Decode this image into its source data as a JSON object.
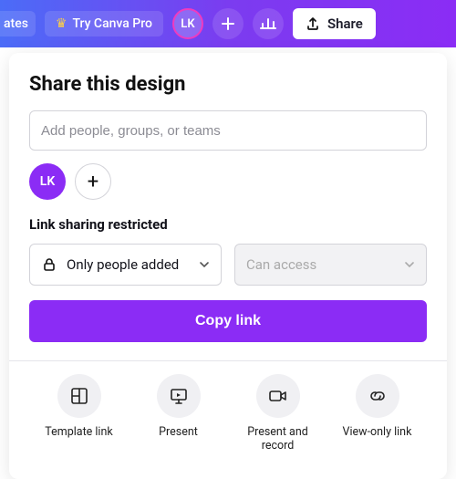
{
  "colors": {
    "accent": "#8b2cf5",
    "arrow": "#f48383"
  },
  "topbar": {
    "templates_label": "ates",
    "try_pro_label": "Try Canva Pro",
    "avatar_initials": "LK",
    "share_label": "Share"
  },
  "panel": {
    "title": "Share this design",
    "people_placeholder": "Add people, groups, or teams",
    "avatar_initials": "LK",
    "link_section_label": "Link sharing restricted",
    "audience_selected": "Only people added",
    "permission_selected": "Can access",
    "copy_button": "Copy link",
    "options": [
      {
        "key": "template-link",
        "label": "Template link"
      },
      {
        "key": "present",
        "label": "Present"
      },
      {
        "key": "present-record",
        "label": "Present and record"
      },
      {
        "key": "view-only",
        "label": "View-only link"
      }
    ]
  }
}
